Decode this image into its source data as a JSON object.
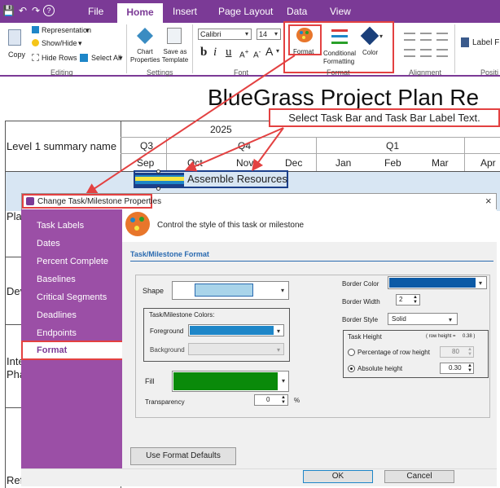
{
  "ribbon": {
    "tabs": [
      "File",
      "Home",
      "Insert",
      "Page Layout",
      "Data",
      "View"
    ],
    "editing": {
      "copy": "Copy",
      "representation": "Representation",
      "show_hide": "Show/Hide",
      "hide_rows": "Hide Rows",
      "select_all": "Select All",
      "label": "Editing"
    },
    "settings": {
      "chart_properties": "Chart Properties",
      "save_as_template": "Save as Template",
      "label": "Settings"
    },
    "font": {
      "family": "Calibri",
      "size": "14",
      "label": "Font"
    },
    "format": {
      "format": "Format",
      "conditional": "Conditional Formatting",
      "color": "Color",
      "label": "Format"
    },
    "alignment": {
      "label": "Alignment"
    },
    "position": {
      "label_prefix": "Label F",
      "label": "Positi"
    }
  },
  "gantt": {
    "title": "BlueGrass Project Plan Re",
    "header_label": "Level 1 summary name",
    "year": "2025",
    "quarters": [
      "Q3",
      "Q4",
      "Q1"
    ],
    "months": [
      "Sep",
      "Oct",
      "Nov",
      "Dec",
      "Jan",
      "Feb",
      "Mar",
      "Apr"
    ],
    "task_label": "Assemble Resources",
    "rows": [
      "Pla",
      "Dev",
      "Inte",
      "Pha",
      "Ref"
    ]
  },
  "callout": "Select Task Bar and Task Bar Label Text.",
  "dialog": {
    "title": "Change Task/Milestone Properties",
    "sidebar": [
      "Task Labels",
      "Dates",
      "Percent Complete",
      "Baselines",
      "Critical Segments",
      "Deadlines",
      "Endpoints",
      "Format"
    ],
    "selected": "Format",
    "header": "Control the style of this task or milestone",
    "section": "Task/Milestone Format",
    "shape_label": "Shape",
    "colors_group": "Task/Milestone Colors:",
    "foreground": "Foreground",
    "background": "Background",
    "fill": "Fill",
    "transparency": "Transparency",
    "transparency_value": "0",
    "percent": "%",
    "border_color": "Border Color",
    "border_width": "Border Width",
    "border_width_value": "2",
    "border_style": "Border Style",
    "border_style_value": "Solid",
    "task_height": "Task Height",
    "row_height_note": "( row height =",
    "row_height_value": "0.38 )",
    "pct_row_height": "Percentage of row height",
    "pct_value": "80",
    "absolute_height": "Absolute height",
    "absolute_value": "0.30",
    "use_defaults": "Use Format Defaults",
    "ok": "OK",
    "cancel": "Cancel",
    "colors": {
      "shape": "#a9d4ea",
      "foreground": "#1e86c8",
      "fill": "#0a8a0a",
      "border": "#0c5aa6",
      "accent": "#7b3a96",
      "sidebar": "#9b4fa6",
      "section": "#2a6ab0"
    }
  }
}
